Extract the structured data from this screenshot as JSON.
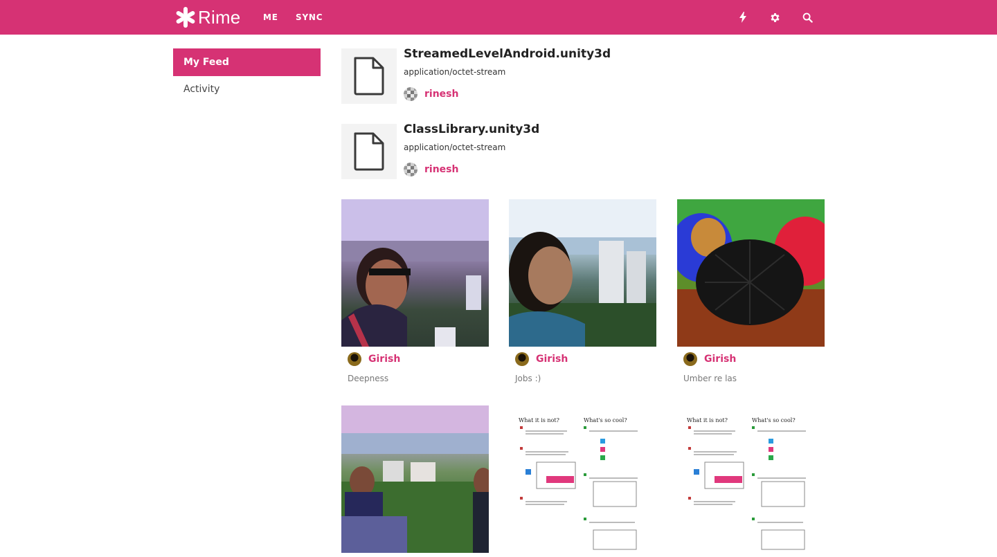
{
  "app": {
    "name": "Rime",
    "accent": "#d63274"
  },
  "topnav": {
    "links": [
      {
        "label": "ME"
      },
      {
        "label": "SYNC"
      }
    ],
    "icons": [
      "bolt-icon",
      "gear-icon",
      "search-icon"
    ]
  },
  "sidebar": {
    "items": [
      {
        "label": "My Feed",
        "active": true
      },
      {
        "label": "Activity",
        "active": false
      }
    ]
  },
  "files": [
    {
      "name": "StreamedLevelAndroid.unity3d",
      "mime": "application/octet-stream",
      "user": "rinesh"
    },
    {
      "name": "ClassLibrary.unity3d",
      "mime": "application/octet-stream",
      "user": "rinesh"
    }
  ],
  "photos": [
    {
      "user": "Girish",
      "caption": "Deepness"
    },
    {
      "user": "Girish",
      "caption": "Jobs :)"
    },
    {
      "user": "Girish",
      "caption": "Umber re las"
    },
    {
      "user": "",
      "caption": ""
    },
    {
      "user": "",
      "caption": ""
    },
    {
      "user": "",
      "caption": ""
    }
  ],
  "doc_preview": {
    "heading_left": "What it is not?",
    "heading_right": "What's so cool?"
  }
}
